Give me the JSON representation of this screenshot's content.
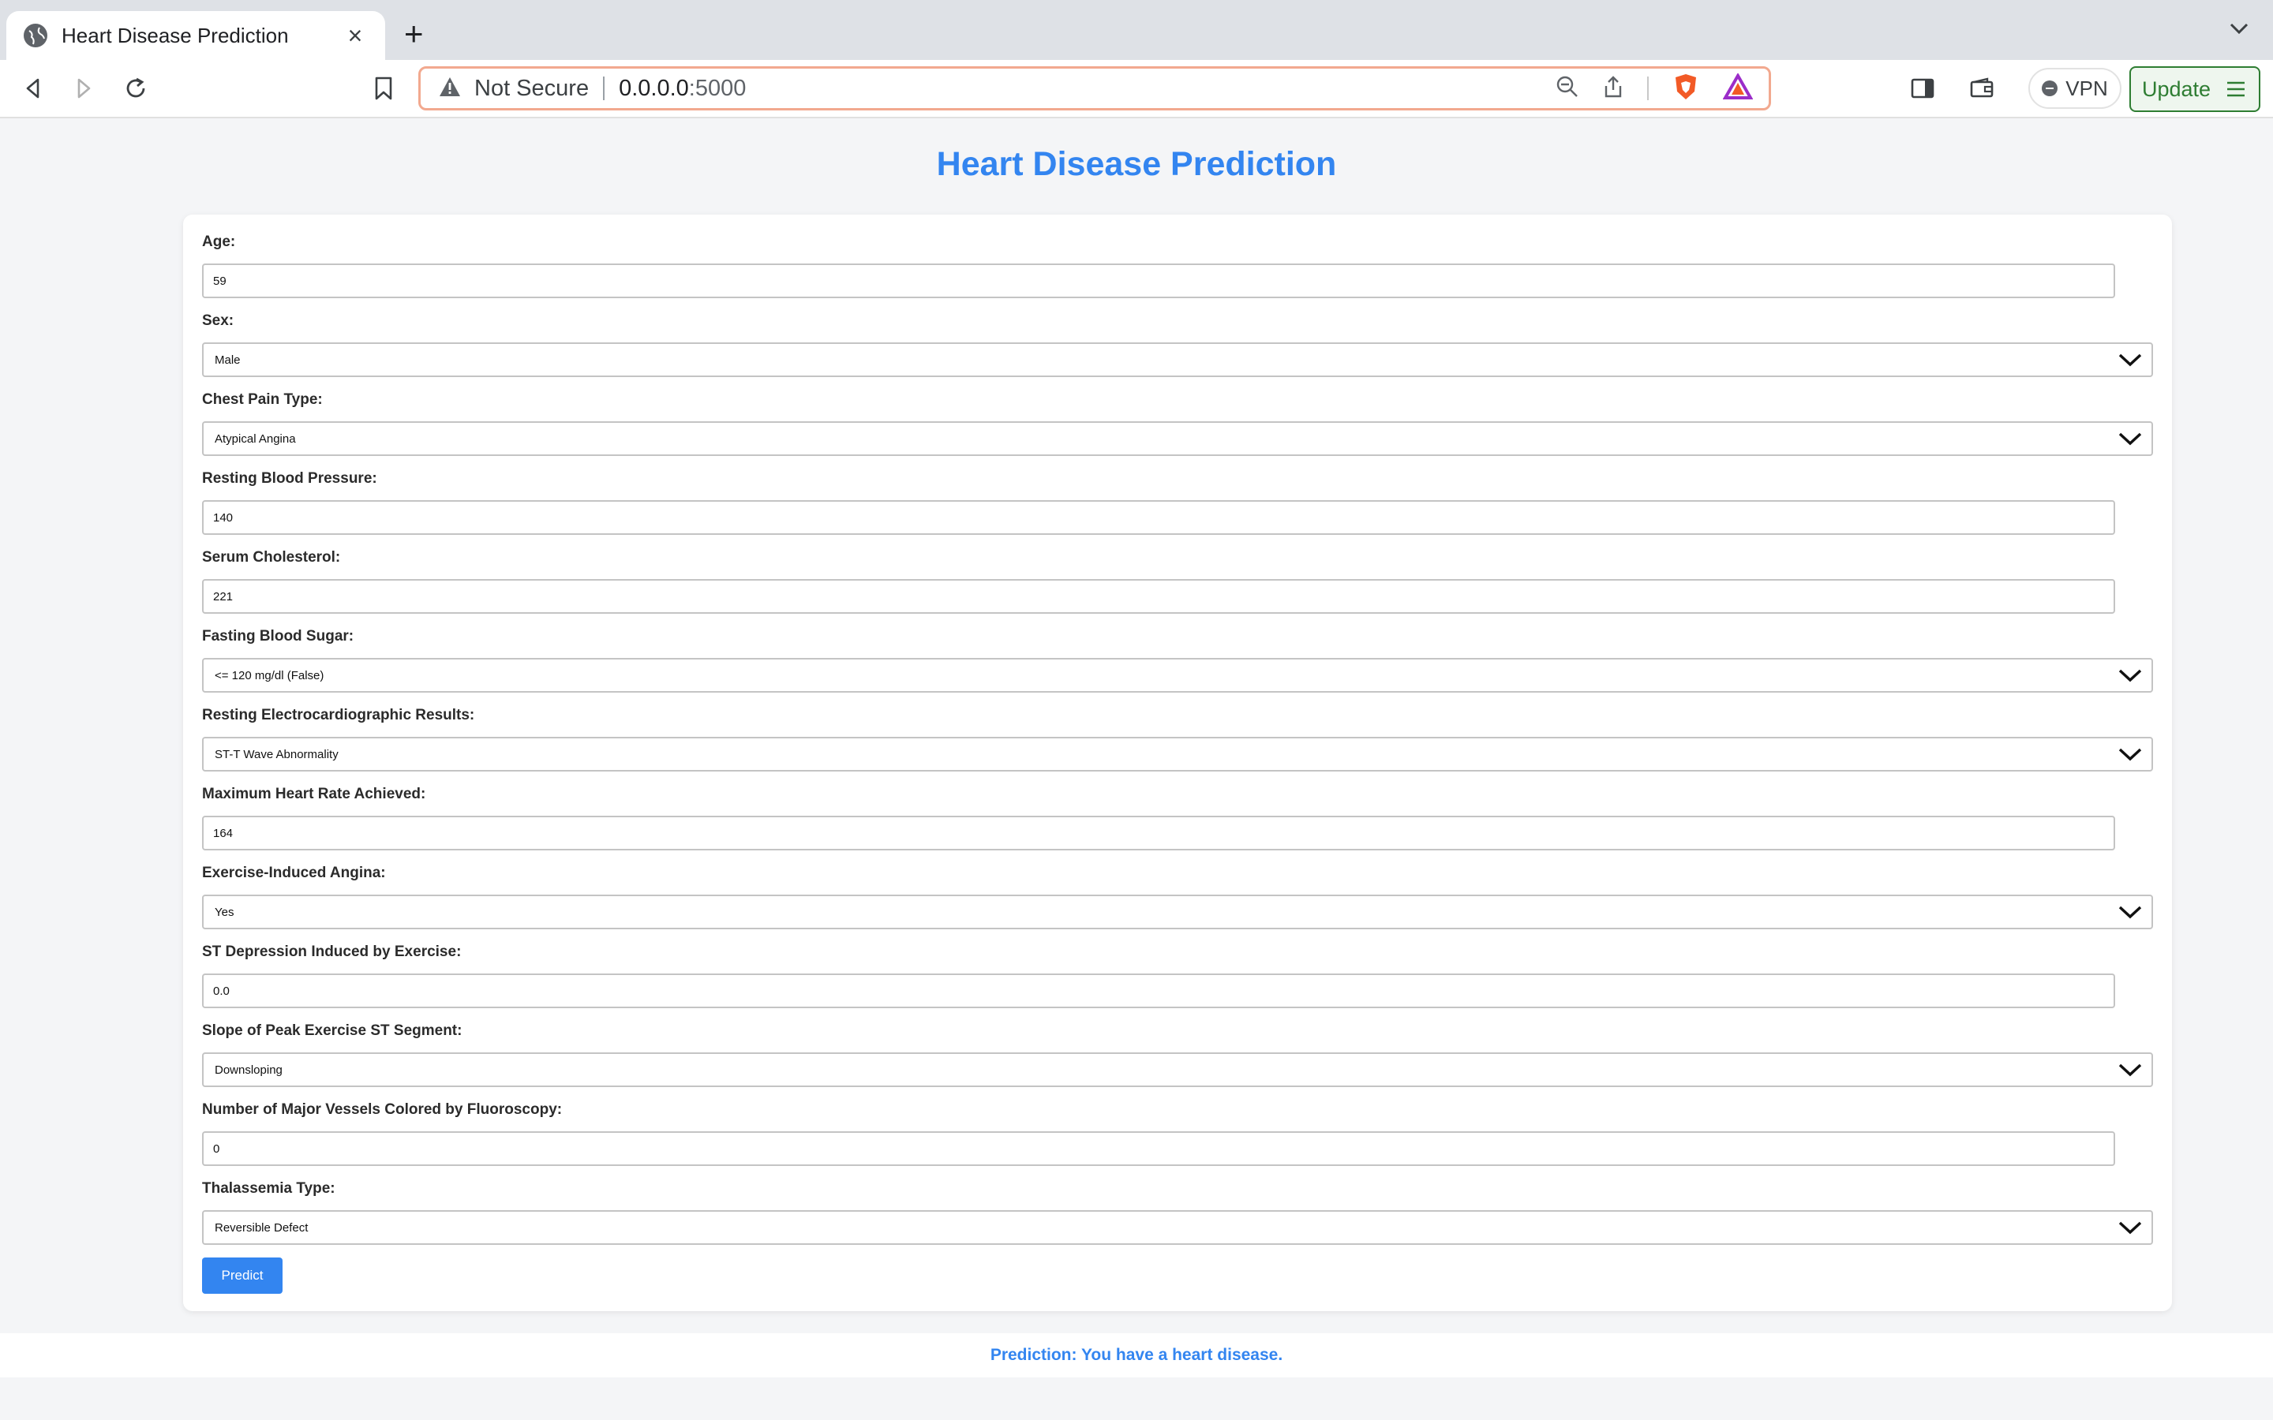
{
  "browser": {
    "tab_title": "Heart Disease Prediction",
    "url_security": "Not Secure",
    "url_host": "0.0.0.0",
    "url_port": ":5000",
    "vpn_label": "VPN",
    "update_label": "Update"
  },
  "page": {
    "title": "Heart Disease Prediction",
    "result": "Prediction: You have a heart disease."
  },
  "form": {
    "age": {
      "label": "Age:",
      "value": "59"
    },
    "sex": {
      "label": "Sex:",
      "value": "Male"
    },
    "chest_pain": {
      "label": "Chest Pain Type:",
      "value": "Atypical Angina"
    },
    "resting_bp": {
      "label": "Resting Blood Pressure:",
      "value": "140"
    },
    "cholesterol": {
      "label": "Serum Cholesterol:",
      "value": "221"
    },
    "fasting_bs": {
      "label": "Fasting Blood Sugar:",
      "value": "<= 120 mg/dl (False)"
    },
    "rest_ecg": {
      "label": "Resting Electrocardiographic Results:",
      "value": "ST-T Wave Abnormality"
    },
    "max_hr": {
      "label": "Maximum Heart Rate Achieved:",
      "value": "164"
    },
    "exercise_angina": {
      "label": "Exercise-Induced Angina:",
      "value": "Yes"
    },
    "st_depression": {
      "label": "ST Depression Induced by Exercise:",
      "value": "0.0"
    },
    "slope": {
      "label": "Slope of Peak Exercise ST Segment:",
      "value": "Downsloping"
    },
    "vessels": {
      "label": "Number of Major Vessels Colored by Fluoroscopy:",
      "value": "0"
    },
    "thal": {
      "label": "Thalassemia Type:",
      "value": "Reversible Defect"
    },
    "submit_label": "Predict"
  },
  "colors": {
    "accent": "#3385f0",
    "update_green": "#2e7d32",
    "url_border": "#f2a98f"
  }
}
